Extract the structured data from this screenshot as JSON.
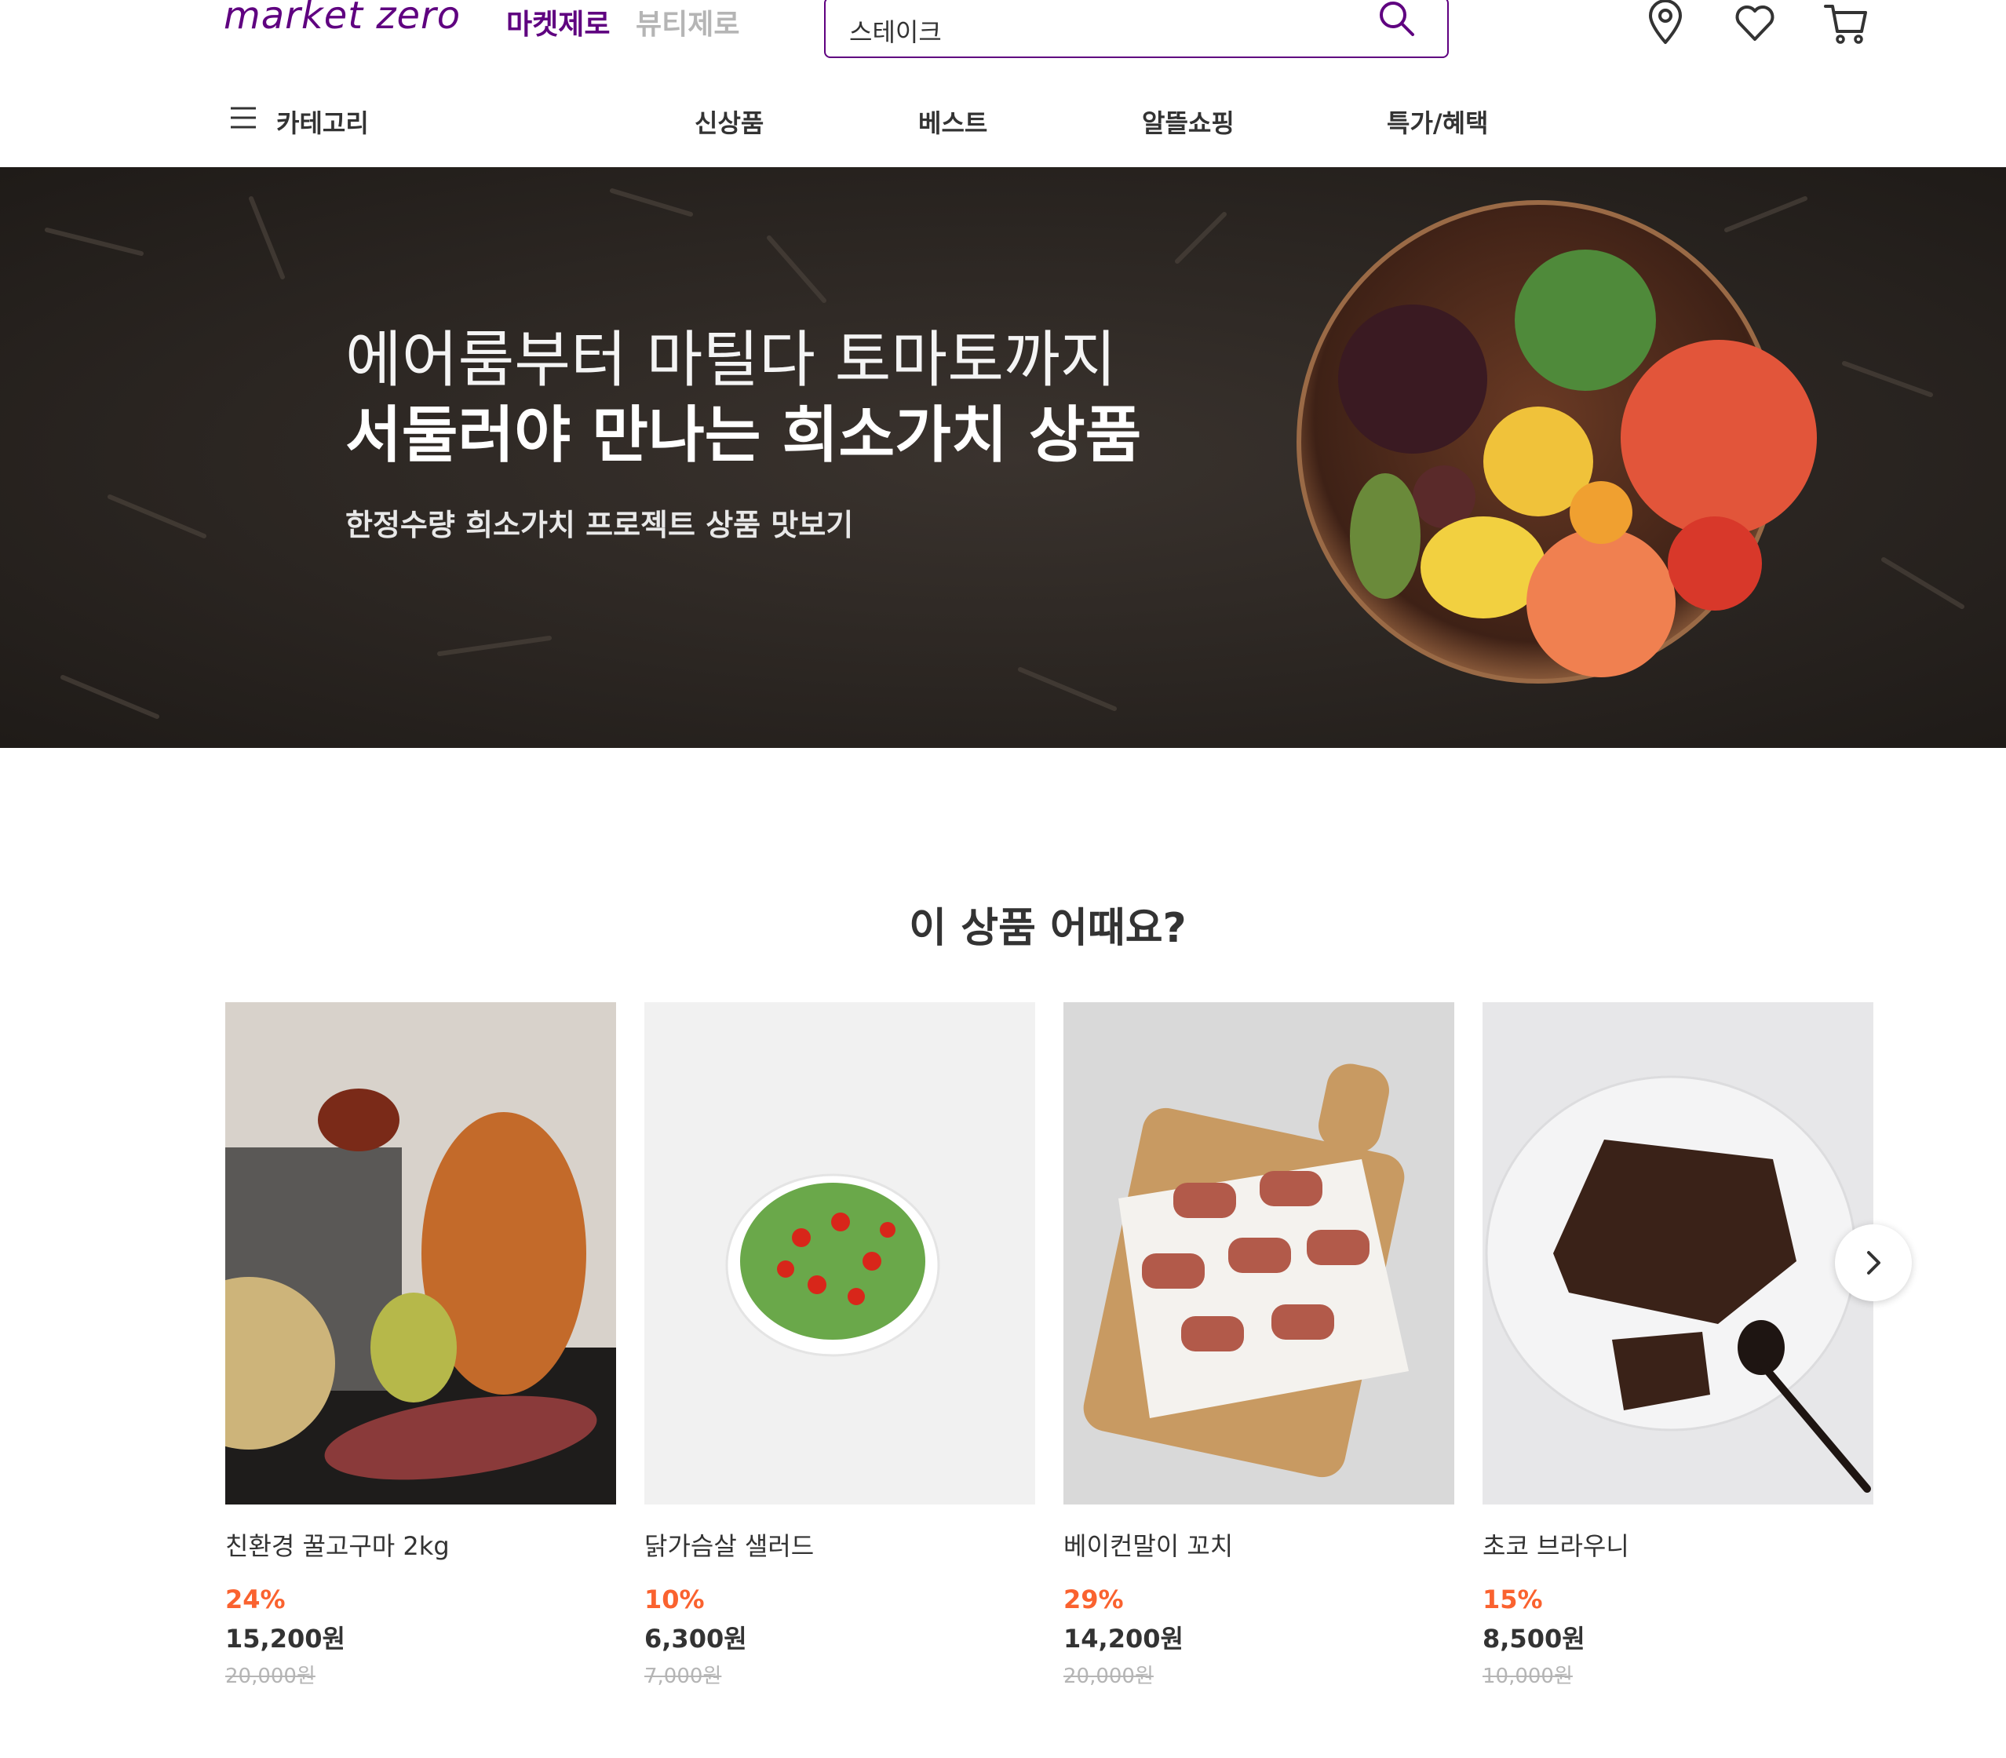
{
  "header": {
    "logo": "market zero",
    "tabs": [
      {
        "label": "마켓제로",
        "active": true
      },
      {
        "label": "뷰티제로",
        "active": false
      }
    ],
    "search": {
      "value": "스테이크"
    },
    "icons": [
      "location-icon",
      "heart-icon",
      "cart-icon"
    ],
    "accent": "#5f0080"
  },
  "nav": {
    "category_label": "카테고리",
    "items": [
      "신상품",
      "베스트",
      "알뜰쇼핑",
      "특가/혜택"
    ]
  },
  "banner": {
    "title_line1": "에어룸부터 마틸다 토마토까지",
    "title_line2": "서둘러야 만나는 희소가치 상품",
    "subtitle": "한정수량 희소가치 프로젝트 상품 맛보기"
  },
  "recommend": {
    "title": "이 상품 어때요?",
    "discount_color": "#fa622f",
    "products": [
      {
        "name": "친환경 꿀고구마 2kg",
        "discount": "24%",
        "price": "15,200원",
        "original": "20,000원"
      },
      {
        "name": "닭가슴살 샐러드",
        "discount": "10%",
        "price": "6,300원",
        "original": "7,000원"
      },
      {
        "name": "베이컨말이 꼬치",
        "discount": "29%",
        "price": "14,200원",
        "original": "20,000원"
      },
      {
        "name": "초코 브라우니",
        "discount": "15%",
        "price": "8,500원",
        "original": "10,000원"
      }
    ]
  }
}
